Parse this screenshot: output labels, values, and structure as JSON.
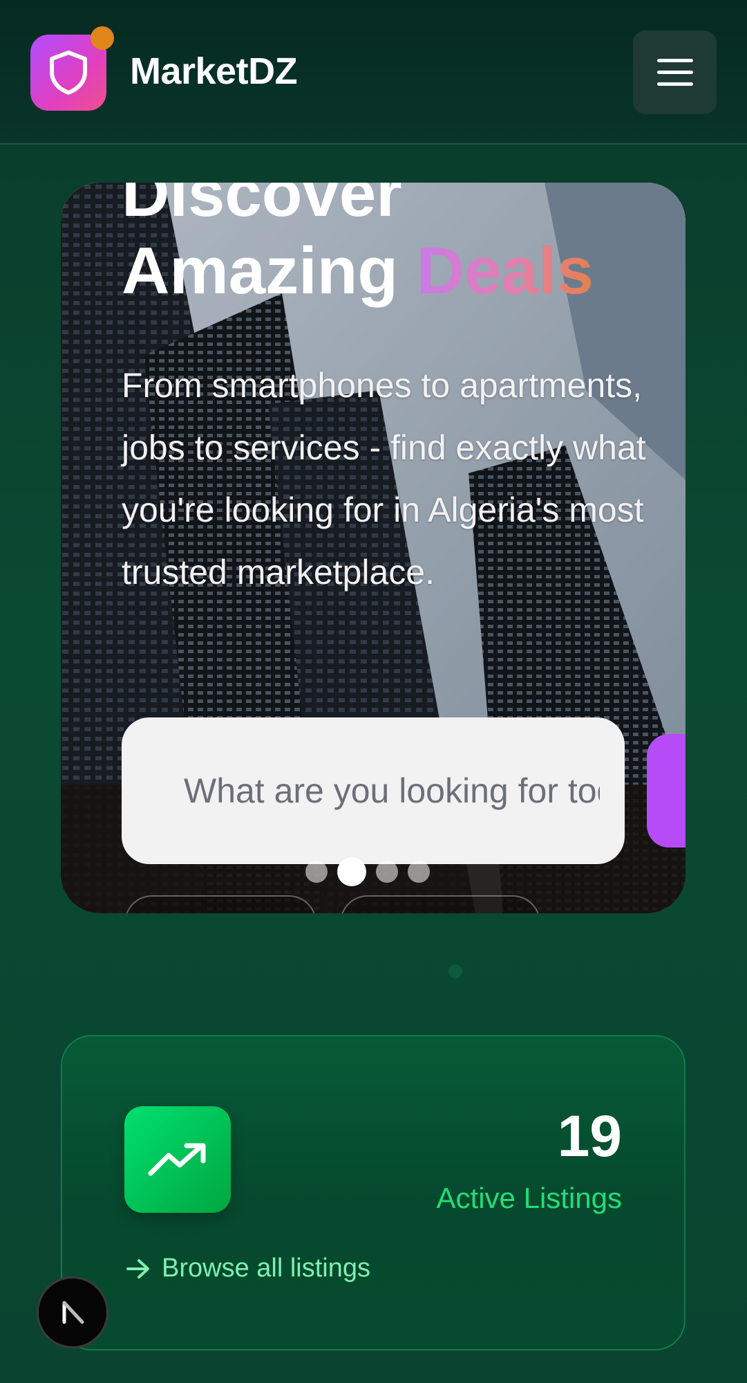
{
  "header": {
    "brand": "MarketDZ",
    "logo_icon": "shield-icon",
    "menu_icon": "hamburger-menu-icon"
  },
  "hero": {
    "title_line1": "Discover",
    "title_line2_plain": "Amazing",
    "title_line2_highlight": "Deals",
    "description": "From smartphones to apartments, jobs to services - find exactly what you're looking for in Algeria's most trusted marketplace.",
    "search_placeholder": "What are you looking for today?",
    "carousel": {
      "slides": 4,
      "active_index": 1
    }
  },
  "stats": {
    "icon": "trending-up-icon",
    "value": "19",
    "label": "Active Listings",
    "link_label": "Browse all listings",
    "link_icon": "arrow-right-icon"
  },
  "colors": {
    "brand_gradient": [
      "#b14cff",
      "#f0508a"
    ],
    "accent_green": "#22dd77",
    "search_button": "#b54cf8"
  }
}
